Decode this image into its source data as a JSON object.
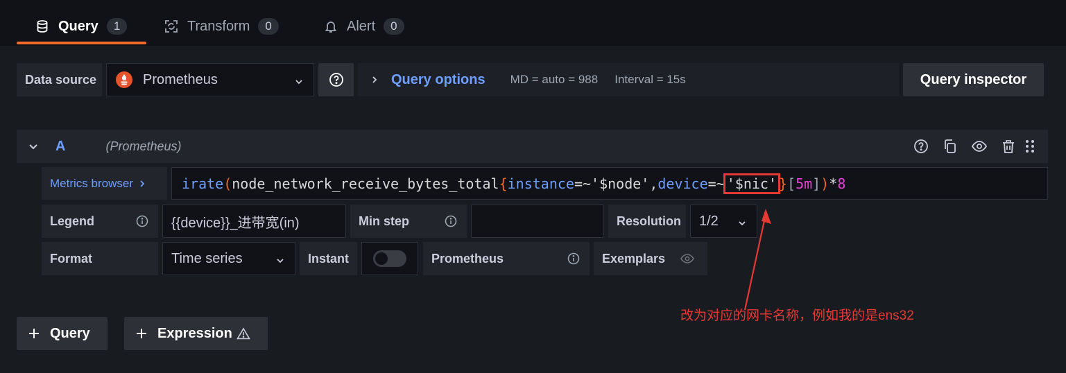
{
  "tabs": [
    {
      "label": "Query",
      "count": "1",
      "icon": "database-icon"
    },
    {
      "label": "Transform",
      "count": "0",
      "icon": "transform-icon"
    },
    {
      "label": "Alert",
      "count": "0",
      "icon": "bell-icon"
    }
  ],
  "datasource": {
    "label": "Data source",
    "value": "Prometheus",
    "help_icon": "question-icon"
  },
  "query_options": {
    "label": "Query options",
    "md": "MD = auto = 988",
    "interval": "Interval = 15s"
  },
  "query_inspector_label": "Query inspector",
  "query_row": {
    "ref_id": "A",
    "datasource_name": "(Prometheus)"
  },
  "metrics_browser_label": "Metrics browser",
  "query_expr": {
    "fn": "irate",
    "metric": "node_network_receive_bytes_total",
    "label1": "instance",
    "op1": "=~",
    "val1": "'$node'",
    "label2": "device",
    "op2": "=~",
    "val2": "'$nic'",
    "range": "5m",
    "multiplier": "8"
  },
  "options": {
    "legend_label": "Legend",
    "legend_value": "{{device}}_进带宽(in)",
    "min_step_label": "Min step",
    "min_step_value": "",
    "resolution_label": "Resolution",
    "resolution_value": "1/2",
    "format_label": "Format",
    "format_value": "Time series",
    "instant_label": "Instant",
    "prometheus_label": "Prometheus",
    "exemplars_label": "Exemplars"
  },
  "bottom": {
    "add_query": "Query",
    "add_expression": "Expression"
  },
  "annotation_text": "改为对应的网卡名称，例如我的是ens32",
  "colors": {
    "accent": "#f2692c",
    "link": "#6e9fff",
    "annotation": "#e53935"
  }
}
